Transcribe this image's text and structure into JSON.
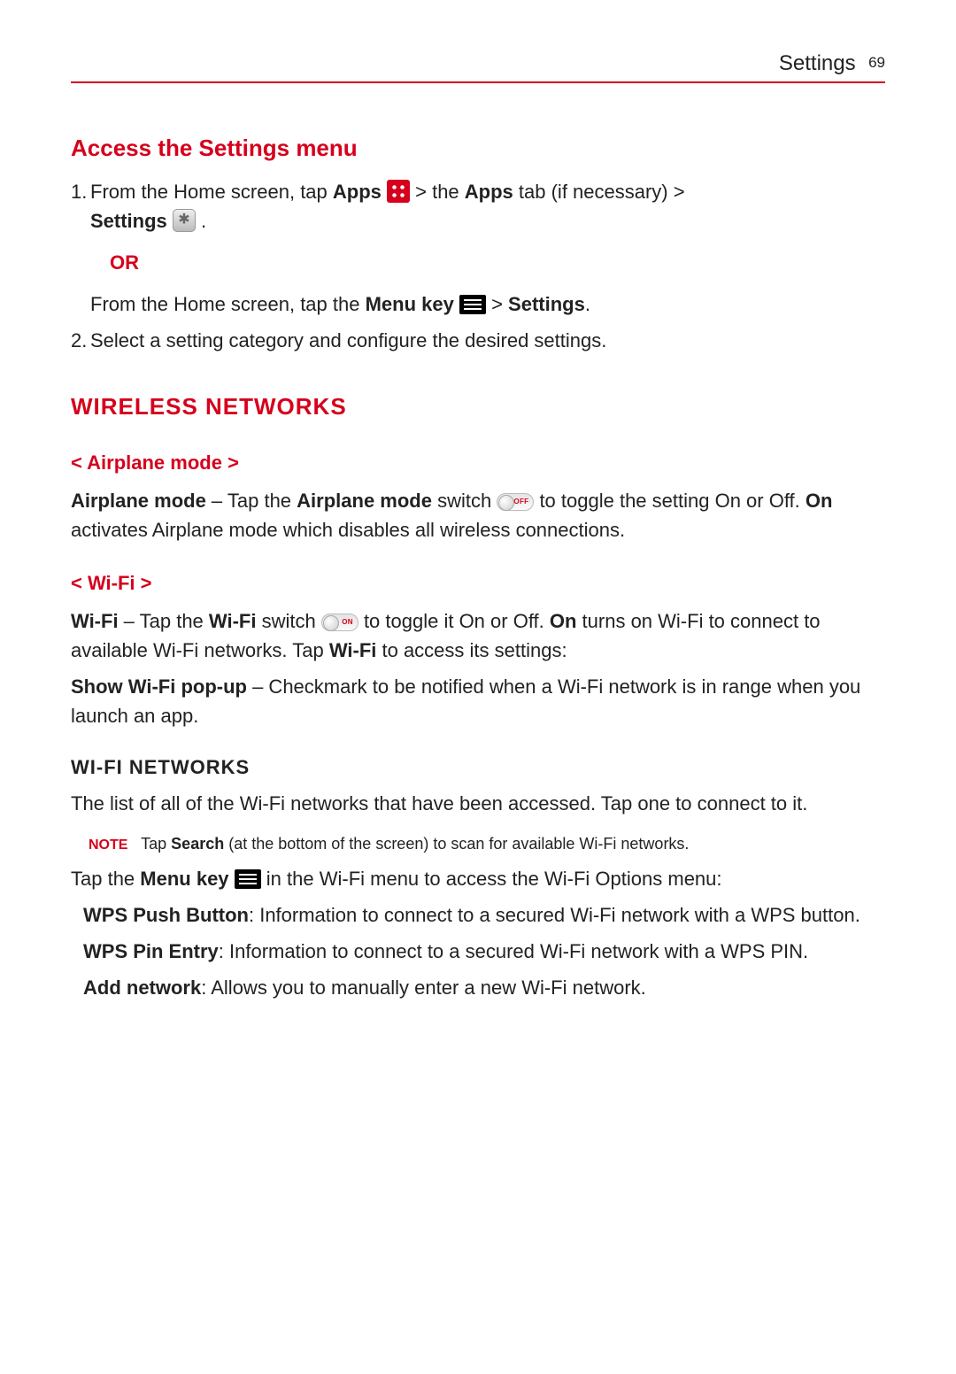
{
  "header": {
    "section": "Settings",
    "page": "69"
  },
  "h1": "Access the Settings menu",
  "step1": {
    "a": "From the Home screen, tap ",
    "apps": "Apps",
    "b": " > the ",
    "appsTab": "Apps",
    "c": " tab (if necessary) > ",
    "settings": "Settings",
    "d": " ."
  },
  "or": "OR",
  "step1alt": {
    "a": "From the Home screen, tap the ",
    "menuKey": "Menu key",
    "b": " > ",
    "settings": "Settings",
    "c": "."
  },
  "step2": "Select a setting category and configure the desired settings.",
  "h2": "WIRELESS NETWORKS",
  "airplaneHeading": "< Airplane mode >",
  "airplane": {
    "b1": "Airplane mode",
    "t1": " – Tap the ",
    "b2": "Airplane mode",
    "t2": " switch ",
    "t3": " to toggle the setting On or Off. ",
    "b3": "On",
    "t4": " activates Airplane mode which disables all wireless connections."
  },
  "wifiHeading": "< Wi-Fi >",
  "wifi": {
    "b1": "Wi-Fi",
    "t1": " – Tap the ",
    "b2": "Wi-Fi",
    "t2": " switch ",
    "t3": " to toggle it On or Off. ",
    "b3": "On",
    "t4": " turns on Wi-Fi to connect to available Wi-Fi networks. Tap ",
    "b4": "Wi-Fi",
    "t5": " to access its settings:"
  },
  "popup": {
    "b1": "Show Wi-Fi pop-up",
    "t1": " – Checkmark to be notified when a Wi-Fi network is in range when you launch an app."
  },
  "wifiNetHeading": "WI-FI NETWORKS",
  "wifiNetDesc": "The list of all of the Wi-Fi networks that have been accessed. Tap one to connect to it.",
  "note": {
    "label": "NOTE",
    "a": "Tap ",
    "b": "Search",
    "c": " (at the bottom of the screen) to scan for available Wi-Fi networks."
  },
  "tapMenu": {
    "a": "Tap the ",
    "b": "Menu key",
    "c": " in the Wi-Fi menu to access the Wi-Fi Options menu:"
  },
  "wps": {
    "b": "WPS Push Button",
    "t": ": Information to connect to a secured Wi-Fi network with a WPS button."
  },
  "wpsPin": {
    "b": "WPS Pin Entry",
    "t": ": Information to connect to a secured Wi-Fi network with a WPS PIN."
  },
  "addNet": {
    "b": "Add network",
    "t": ": Allows you to manually enter a new Wi-Fi network."
  },
  "switchLabels": {
    "off": "OFF",
    "on": "ON"
  }
}
